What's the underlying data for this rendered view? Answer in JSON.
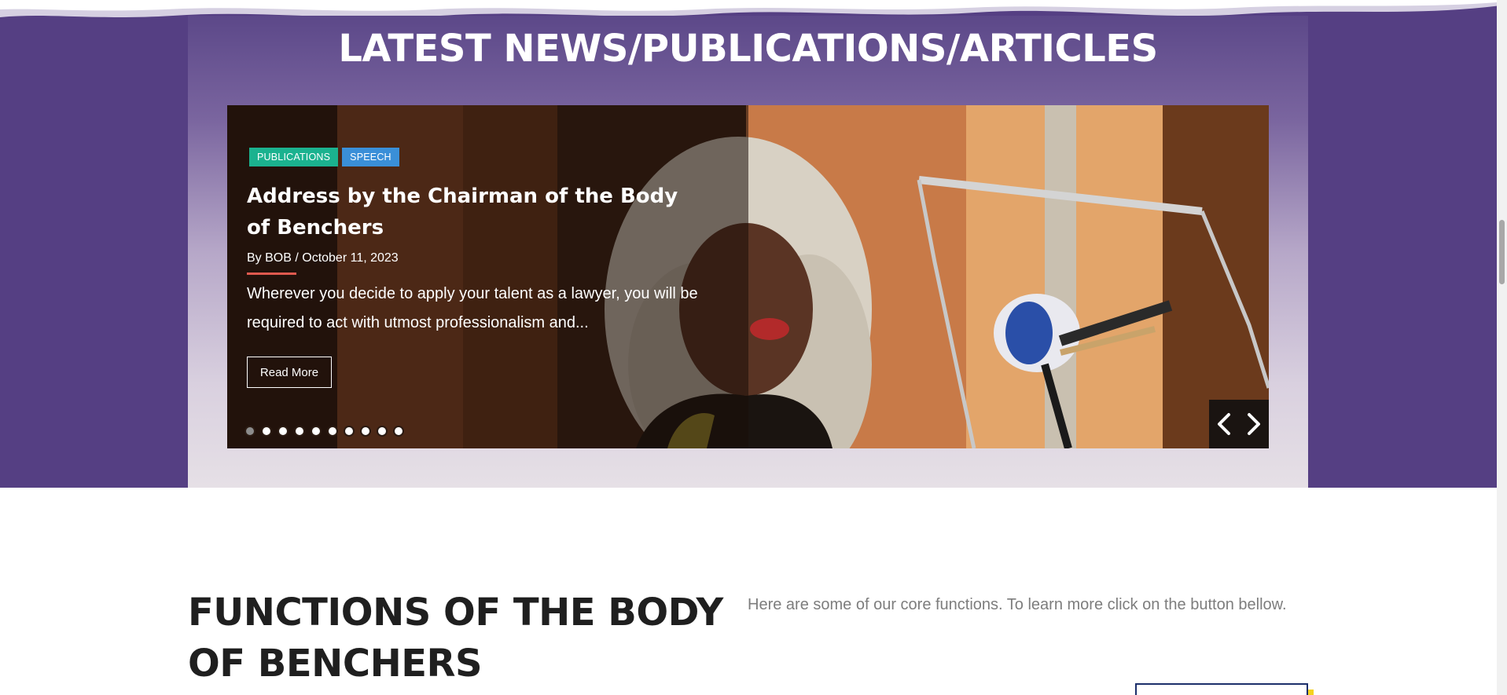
{
  "news": {
    "heading": "LATEST NEWS/PUBLICATIONS/ARTICLES",
    "slide": {
      "tags": [
        "PUBLICATIONS",
        "SPEECH"
      ],
      "title": "Address by the Chairman of the Body of Benchers",
      "byline": "By BOB / October 11, 2023",
      "excerpt": "Wherever you decide to apply your talent as a lawyer, you will be required to act with utmost professionalism and...",
      "read_more_label": "Read More",
      "slide_count": 10,
      "active_slide": 1
    },
    "nav": {
      "prev_icon": "chevron-left-icon",
      "next_icon": "chevron-right-icon"
    }
  },
  "functions": {
    "title": "FUNCTIONS OF THE BODY OF BENCHERS",
    "description": "Here are some of our core functions. To learn more click on the button bellow."
  },
  "colors": {
    "band": "#553f83",
    "tag_publications": "#1bb28f",
    "tag_speech": "#3a8fd8",
    "underline_accent": "#e05a4f",
    "button_border": "#1c2f6b"
  }
}
